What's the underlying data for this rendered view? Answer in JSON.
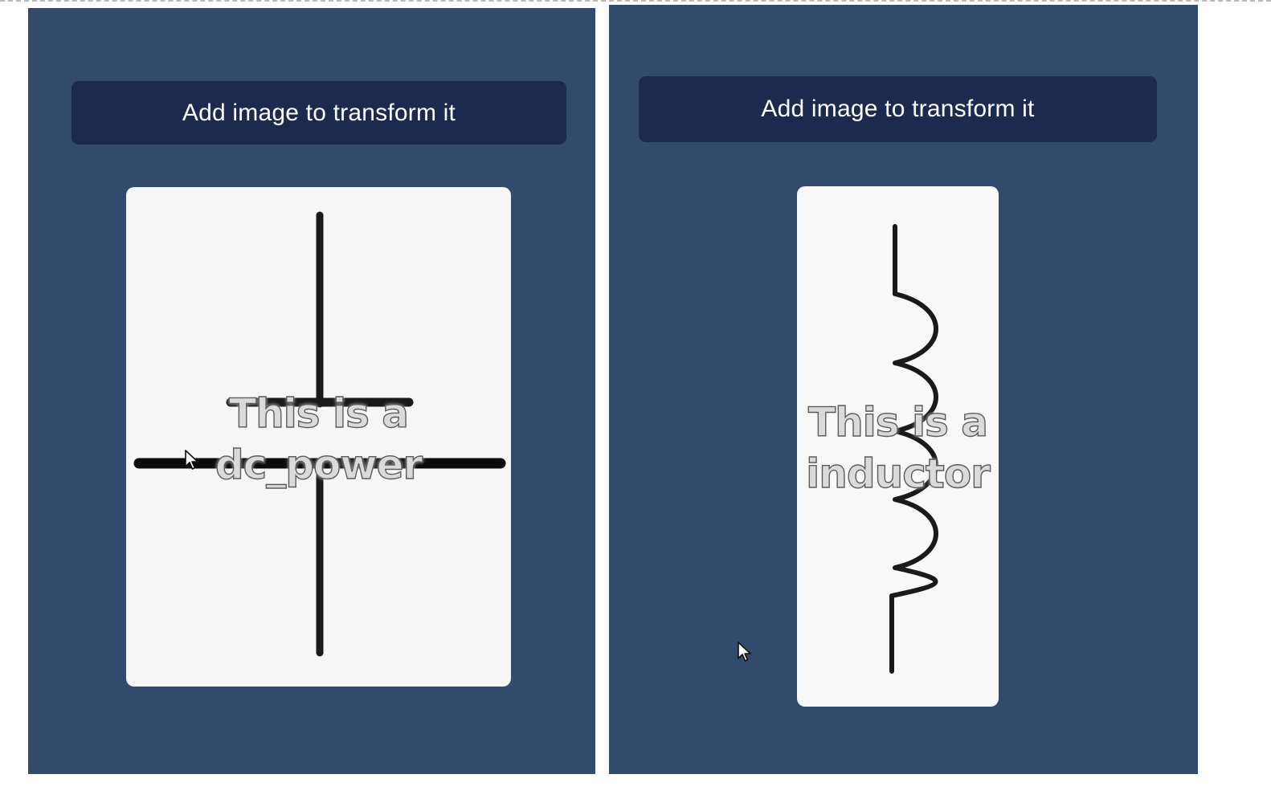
{
  "panels": [
    {
      "upload_button_label": "Add image to transform it",
      "caption_line1": "This is a",
      "caption_line2": "dc_power",
      "symbol": "dc-power-symbol"
    },
    {
      "upload_button_label": "Add image to transform it",
      "caption_line1": "This is a",
      "caption_line2": "inductor",
      "symbol": "inductor-symbol"
    }
  ],
  "colors": {
    "panel_background": "#324a6b",
    "button_background": "#1b2a4e",
    "card_background": "#f6f6f6"
  },
  "icons": {
    "pointer": "mouse-cursor-icon"
  }
}
